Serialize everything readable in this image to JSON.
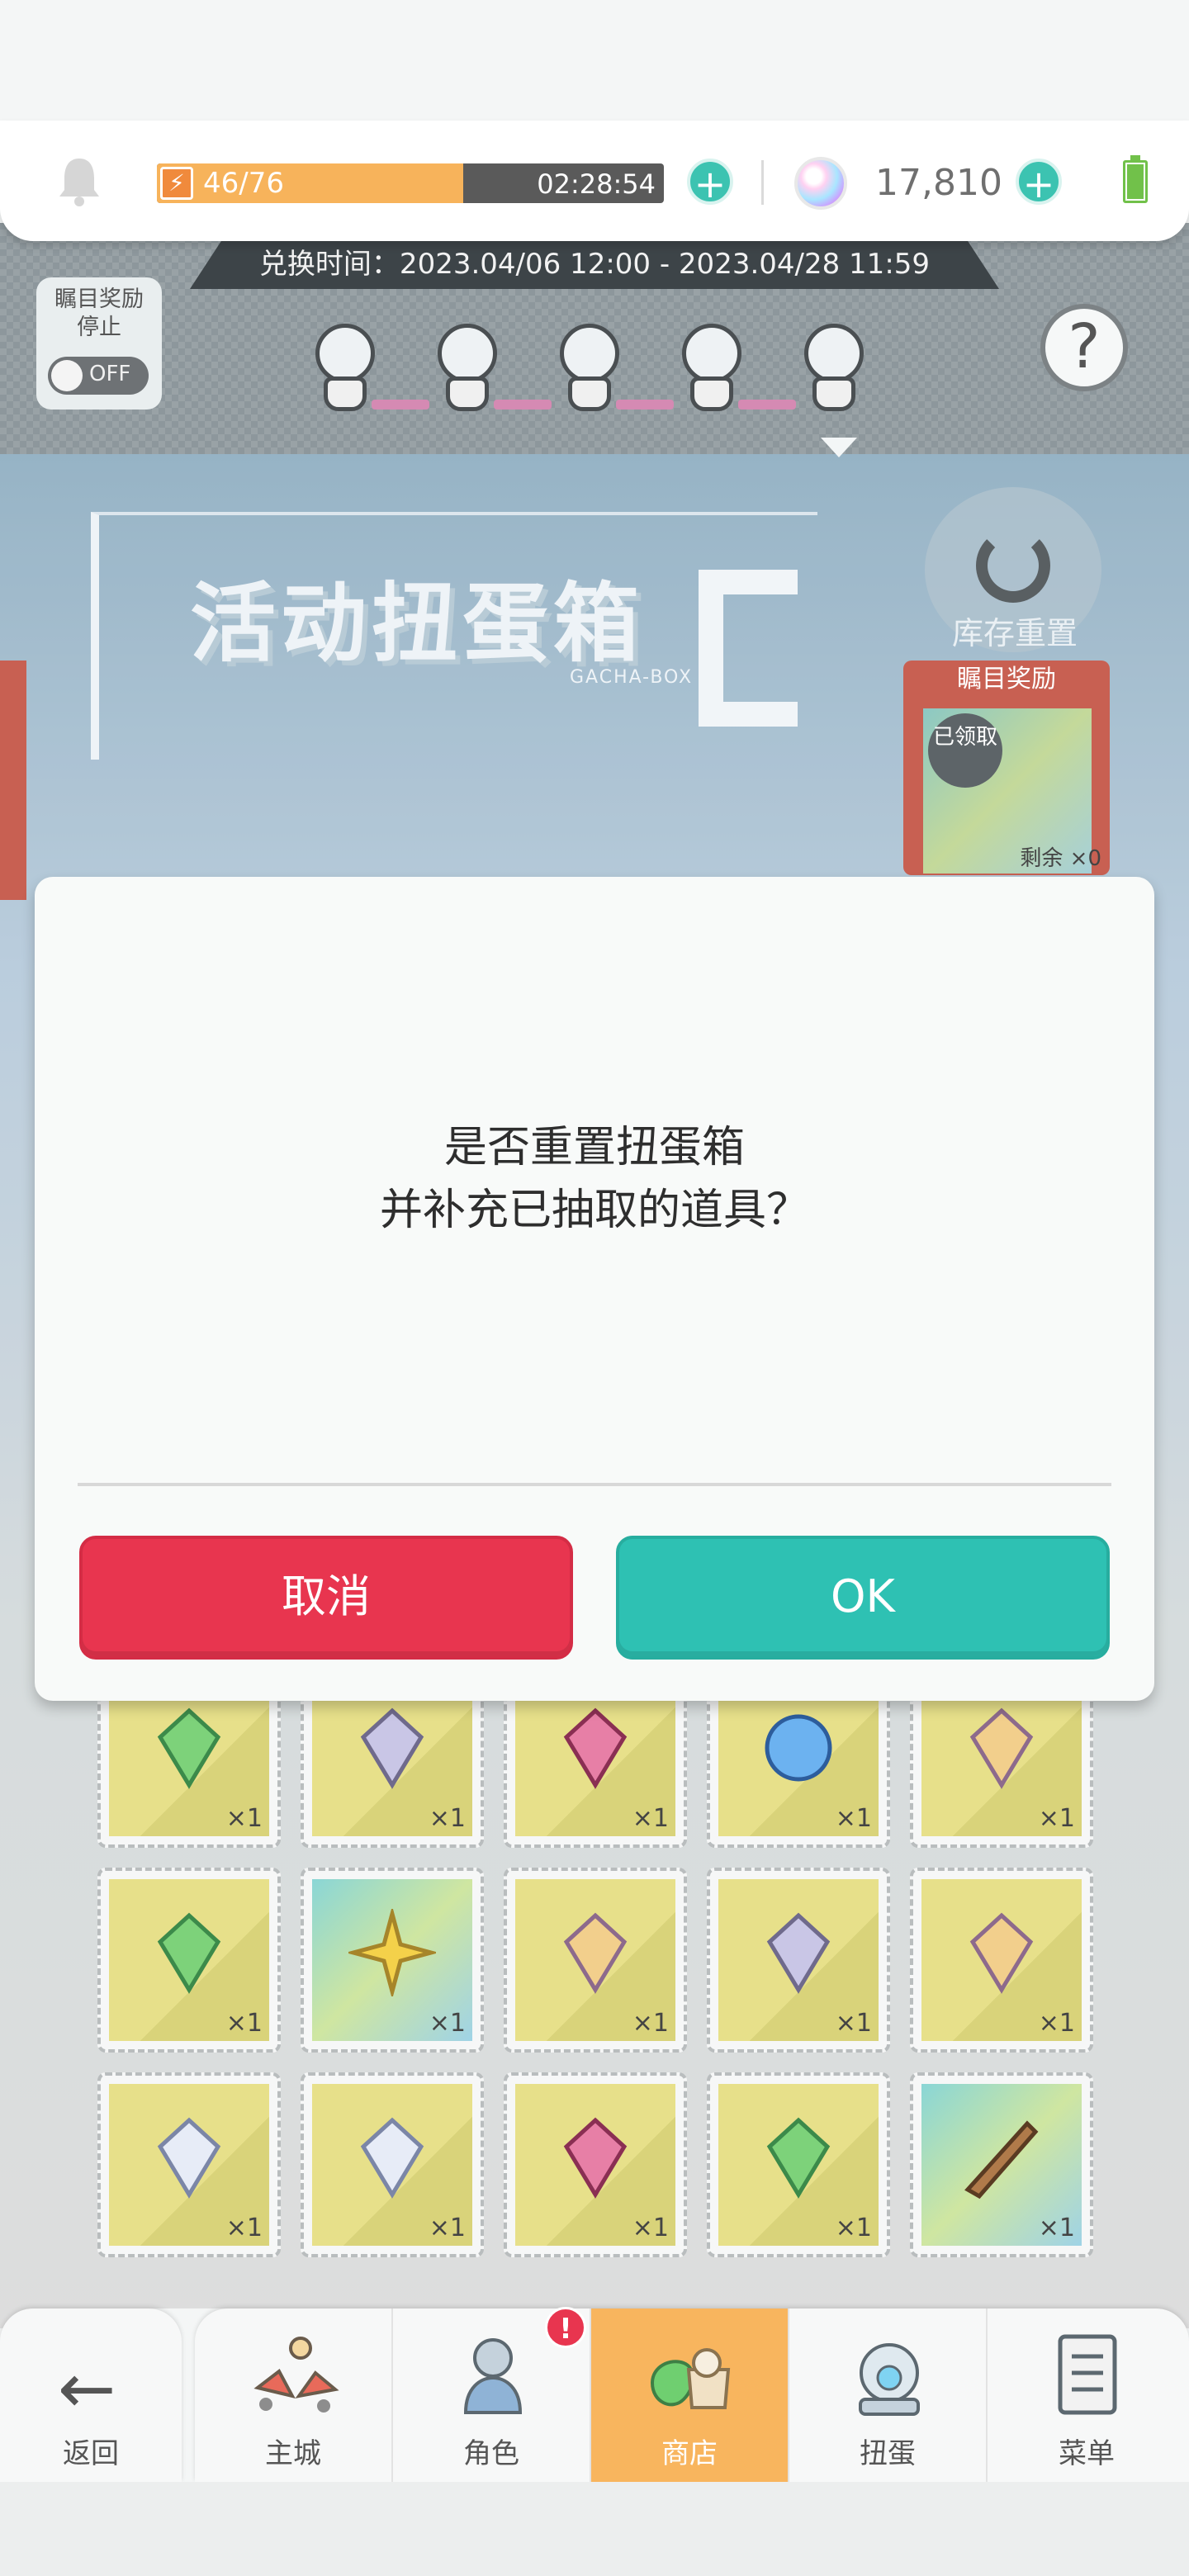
{
  "status_bar": {
    "stamina_value": "46/76",
    "stamina_fraction": 0.605,
    "stamina_timer": "02:28:54",
    "gems": "17,810"
  },
  "event": {
    "exchange_time": "兑换时间：2023.04/06 12:00 - 2023.04/28 11:59",
    "auto_reward_label": "瞩目奖励\n停止",
    "toggle_state": "OFF",
    "help_label": "?",
    "title": "活动扭蛋箱",
    "title_subtitle": "GACHA-BOX",
    "reset_inventory_label": "库存重置",
    "featured_reward": {
      "header": "瞩目奖励",
      "claimed_label": "已领取",
      "remaining": "剩余 ×0"
    }
  },
  "dialog": {
    "message_line1": "是否重置扭蛋箱",
    "message_line2": "并补充已抽取的道具？",
    "cancel_label": "取消",
    "ok_label": "OK"
  },
  "items": [
    {
      "icon": "green-crystal-icon",
      "qty": "×1"
    },
    {
      "icon": "silver-gem-icon",
      "qty": "×1"
    },
    {
      "icon": "pink-crystal-icon",
      "qty": "×1"
    },
    {
      "icon": "blue-orb-icon",
      "qty": "×1"
    },
    {
      "icon": "gold-emblem-icon",
      "qty": "×1"
    },
    {
      "icon": "green-crystal-icon",
      "qty": "×1"
    },
    {
      "icon": "gold-star-icon",
      "qty": "×1"
    },
    {
      "icon": "gold-emblem-icon",
      "qty": "×1"
    },
    {
      "icon": "silver-gem-icon",
      "qty": "×1"
    },
    {
      "icon": "gold-emblem-icon",
      "qty": "×1"
    },
    {
      "icon": "white-crystal-icon",
      "qty": "×1"
    },
    {
      "icon": "white-crystal-icon",
      "qty": "×1"
    },
    {
      "icon": "pink-crystal-icon",
      "qty": "×1"
    },
    {
      "icon": "green-crystal-icon",
      "qty": "×1"
    },
    {
      "icon": "rocket-launcher-icon",
      "qty": "×1"
    }
  ],
  "nav": {
    "back_label": "返回",
    "tabs": [
      {
        "label": "主城",
        "icon": "town-icon"
      },
      {
        "label": "角色",
        "icon": "character-icon",
        "badge": "!"
      },
      {
        "label": "商店",
        "icon": "shop-icon",
        "active": true
      },
      {
        "label": "扭蛋",
        "icon": "gacha-icon"
      },
      {
        "label": "菜单",
        "icon": "menu-icon"
      }
    ]
  },
  "colors": {
    "cancel": "#e8354f",
    "ok": "#2ec1b3",
    "stamina": "#f7b35b",
    "active_tab": "#f8b55e"
  }
}
